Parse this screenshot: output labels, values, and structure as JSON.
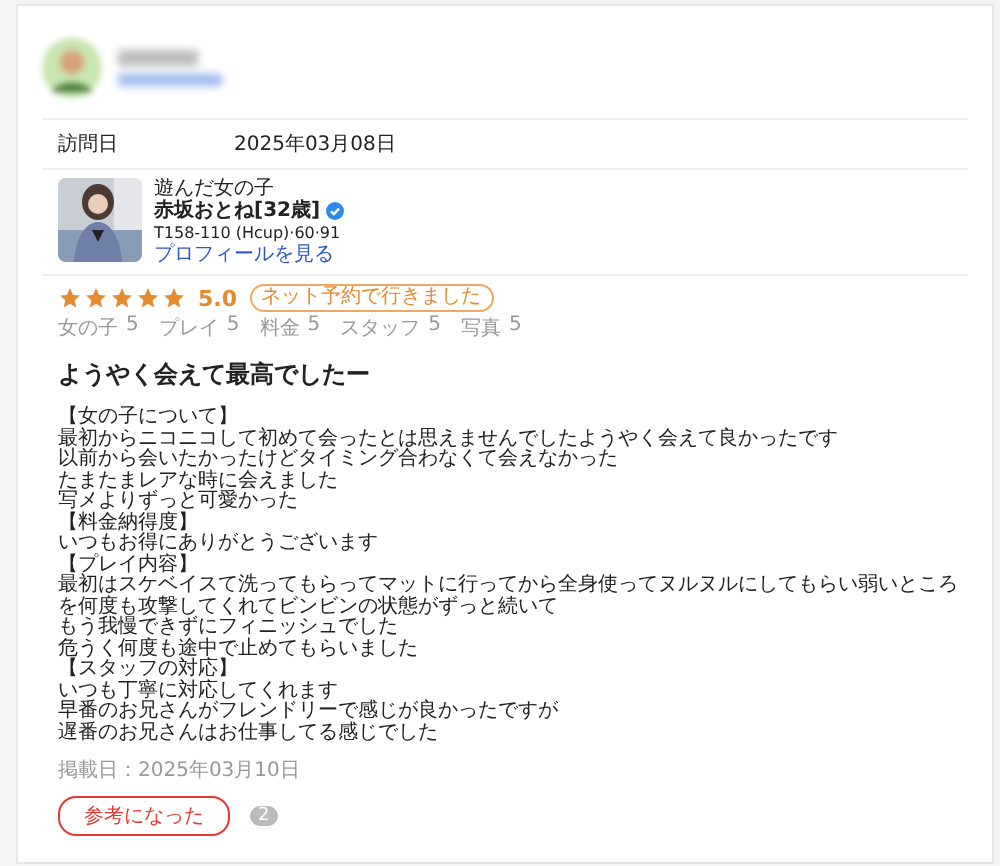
{
  "visit": {
    "label": "訪問日",
    "value": "2025年03月08日"
  },
  "girl": {
    "caption": "遊んだ女の子",
    "name": "赤坂おとね[32歳]",
    "verified": true,
    "stats": "T158-110 (Hcup)·60·91",
    "profile_link": "プロフィールを見る"
  },
  "rating": {
    "stars": 5,
    "score": "5.0",
    "tag": "ネット予約で行きました"
  },
  "sub_scores": [
    {
      "label": "女の子",
      "score": "5"
    },
    {
      "label": "プレイ",
      "score": "5"
    },
    {
      "label": "料金",
      "score": "5"
    },
    {
      "label": "スタッフ",
      "score": "5"
    },
    {
      "label": "写真",
      "score": "5"
    }
  ],
  "review": {
    "title": "ようやく会えて最高でしたー",
    "lines": [
      "【女の子について】",
      "最初からニコニコして初めて会ったとは思えませんでしたようやく会えて良かったです",
      "以前から会いたかったけどタイミング合わなくて会えなかった",
      "たまたまレアな時に会えました",
      "写メよりずっと可愛かった",
      "【料金納得度】",
      "いつもお得にありがとうございます",
      "【プレイ内容】",
      "最初はスケベイスて洗ってもらってマットに行ってから全身使ってヌルヌルにしてもらい弱いところを何度も攻撃してくれてビンビンの状態がずっと続いて",
      "もう我慢できずにフィニッシュでした",
      "危うく何度も途中で止めてもらいました",
      "【スタッフの対応】",
      "いつも丁寧に対応してくれます",
      "早番のお兄さんがフレンドリーで感じが良かったですが",
      "遅番のお兄さんはお仕事してる感じでした"
    ],
    "posted": "掲載日：2025年03月10日"
  },
  "helpful": {
    "label": "参考になった",
    "count": "2"
  }
}
